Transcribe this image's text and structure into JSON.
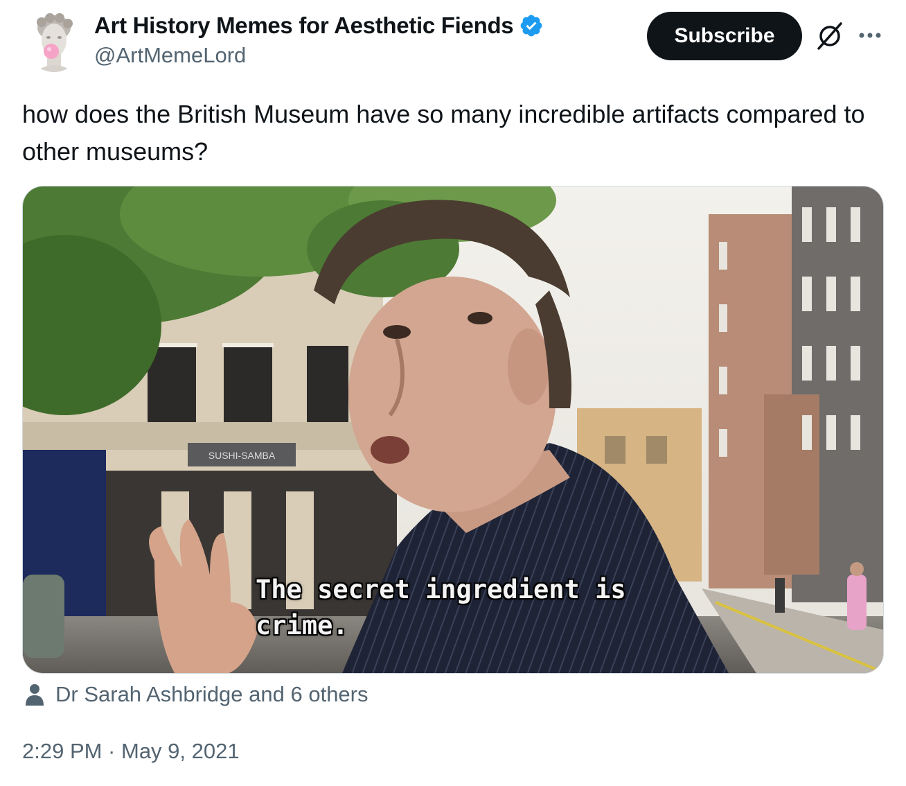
{
  "author": {
    "name": "Art History Memes for Aesthetic Fiends",
    "handle": "@ArtMemeLord",
    "verified": true,
    "avatar": "marble-statue-bubblegum-avatar"
  },
  "actions": {
    "subscribe_label": "Subscribe",
    "grok_icon": "slashed-circle-icon",
    "more_icon": "ellipsis-icon"
  },
  "tweet": {
    "text": "how does the British Museum have so many incredible artifacts compared to other museums?",
    "media": {
      "subtitle_line1": "The secret ingredient is",
      "subtitle_line2": "crime.",
      "shop_sign": "SUSHI-SAMBA"
    },
    "tagged": "Dr Sarah Ashbridge and 6 others",
    "timestamp": "2:29 PM · May 9, 2021"
  },
  "colors": {
    "text_primary": "#0f1419",
    "text_secondary": "#536471",
    "verified_blue": "#1d9bf0",
    "button_bg": "#0f1419"
  }
}
